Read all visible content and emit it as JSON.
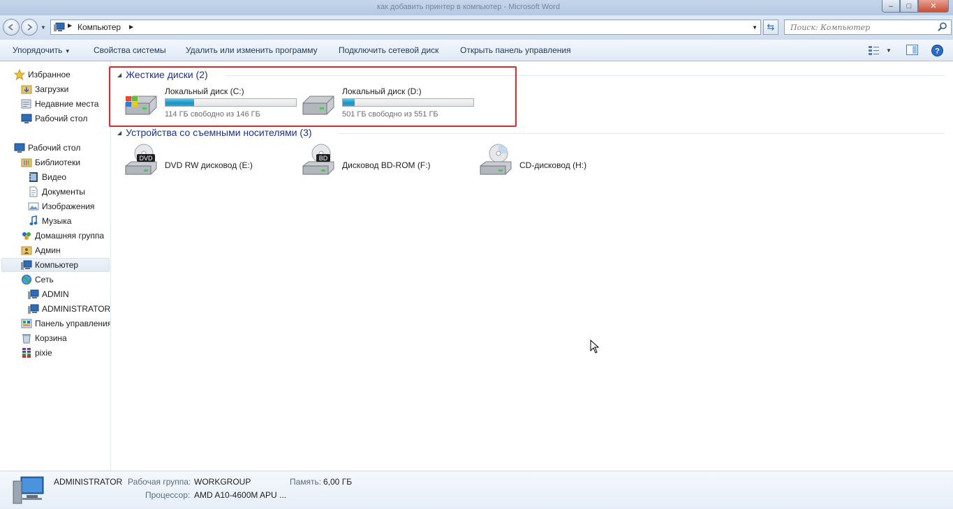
{
  "window": {
    "title": "как добавить принтер в компьютер - Microsoft Word",
    "buttons": {
      "minimize": "–",
      "maximize": "□",
      "close": "✕"
    }
  },
  "address": {
    "breadcrumb": "Компьютер",
    "search_placeholder": "Поиск: Компьютер"
  },
  "toolbar": {
    "organize": "Упорядочить",
    "system_props": "Свойства системы",
    "uninstall": "Удалить или изменить программу",
    "map_drive": "Подключить сетевой диск",
    "control_panel": "Открыть панель управления"
  },
  "sidebar": {
    "items": [
      {
        "label": "Избранное",
        "icon": "star-icon"
      },
      {
        "label": "Загрузки",
        "icon": "downloads-folder-icon"
      },
      {
        "label": "Недавние места",
        "icon": "recent-places-icon"
      },
      {
        "label": "Рабочий стол",
        "icon": "desktop-icon"
      },
      {
        "label": "Рабочий стол",
        "icon": "desktop-icon"
      },
      {
        "label": "Библиотеки",
        "icon": "libraries-icon"
      },
      {
        "label": "Видео",
        "icon": "video-icon"
      },
      {
        "label": "Документы",
        "icon": "documents-icon"
      },
      {
        "label": "Изображения",
        "icon": "pictures-icon"
      },
      {
        "label": "Музыка",
        "icon": "music-icon"
      },
      {
        "label": "Домашняя группа",
        "icon": "homegroup-icon"
      },
      {
        "label": "Админ",
        "icon": "user-folder-icon"
      },
      {
        "label": "Компьютер",
        "icon": "computer-icon"
      },
      {
        "label": "Сеть",
        "icon": "network-icon"
      },
      {
        "label": "ADMIN",
        "icon": "network-computer-icon"
      },
      {
        "label": "ADMINISTRATOR",
        "icon": "network-computer-icon"
      },
      {
        "label": "Панель управления",
        "icon": "control-panel-icon"
      },
      {
        "label": "Корзина",
        "icon": "recycle-bin-icon"
      },
      {
        "label": "pixie",
        "icon": "archive-icon"
      }
    ]
  },
  "content": {
    "hard_disks": {
      "header": "Жесткие диски (2)",
      "drives": [
        {
          "name": "Локальный диск (C:)",
          "free": "114 ГБ свободно из 146 ГБ",
          "used_fraction": 0.22,
          "icon": "windows-drive-icon"
        },
        {
          "name": "Локальный диск (D:)",
          "free": "501 ГБ свободно из 551 ГБ",
          "used_fraction": 0.09,
          "icon": "hard-drive-icon"
        }
      ]
    },
    "removable": {
      "header": "Устройства со съемными носителями (3)",
      "devices": [
        {
          "name": "DVD RW дисковод (E:)",
          "badge": "DVD",
          "icon": "dvd-drive-icon"
        },
        {
          "name": "Дисковод BD-ROM (F:)",
          "badge": "BD",
          "icon": "bd-drive-icon"
        },
        {
          "name": "CD-дисковод (H:)",
          "badge": "",
          "icon": "cd-drive-icon"
        }
      ]
    }
  },
  "details": {
    "computer_name": "ADMINISTRATOR",
    "workgroup_label": "Рабочая группа:",
    "workgroup_value": "WORKGROUP",
    "memory_label": "Память:",
    "memory_value": "6,00 ГБ",
    "cpu_label": "Процессор:",
    "cpu_value": "AMD A10-4600M APU ..."
  },
  "colors": {
    "accent_header": "#1e3287",
    "highlight_border": "#d22c2c",
    "bar_fill": "#1c93c2"
  }
}
